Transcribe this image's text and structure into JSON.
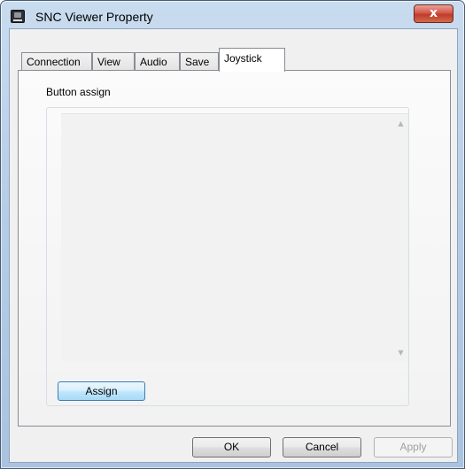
{
  "window": {
    "title": "SNC Viewer Property",
    "close_label": "x"
  },
  "tabs": [
    {
      "label": "Connection",
      "active": false
    },
    {
      "label": "View",
      "active": false
    },
    {
      "label": "Audio",
      "active": false
    },
    {
      "label": "Save",
      "active": false
    },
    {
      "label": "Joystick",
      "active": true
    }
  ],
  "joystick": {
    "group_title": "Button assign",
    "assign_label": "Assign",
    "button_list": []
  },
  "footer": {
    "ok_label": "OK",
    "cancel_label": "Cancel",
    "apply_label": "Apply",
    "apply_enabled": false
  },
  "icons": {
    "app": "snc-viewer-app-icon",
    "close": "close-icon",
    "scroll_up": "chevron-up-icon",
    "scroll_down": "chevron-down-icon"
  },
  "colors": {
    "close_button": "#c9483a",
    "assign_focus": "#3c7fb1",
    "dialog_background": "#f0f0f0"
  }
}
